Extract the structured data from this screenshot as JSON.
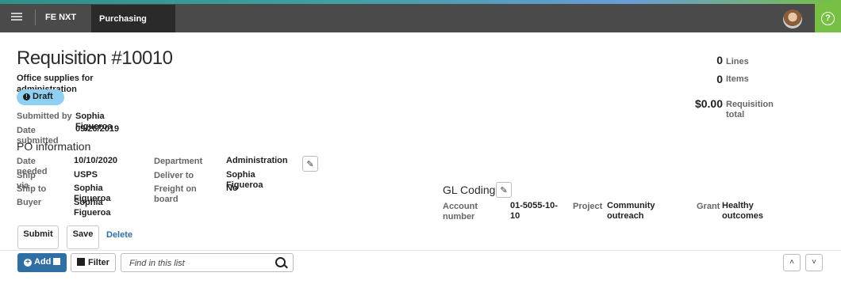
{
  "nav": {
    "app_name": "FE NXT",
    "active_tab": "Purchasing",
    "help_label": "?"
  },
  "header": {
    "title": "Requisition #10010",
    "description": "Office supplies for administration",
    "status": "Draft",
    "status_icon": "!"
  },
  "details": {
    "submitted_by_label": "Submitted by",
    "submitted_by_value": "Sophia Figueroa",
    "date_submitted_label": "Date submitted",
    "date_submitted_value": "09/26/2019"
  },
  "stats": [
    {
      "value": "0",
      "label": "Lines"
    },
    {
      "value": "0",
      "label": "Items"
    },
    {
      "value": "$0.00",
      "label": "Requisition total"
    }
  ],
  "po": {
    "section_title": "PO information",
    "date_needed_label": "Date needed",
    "date_needed_value": "10/10/2020",
    "ship_via_label": "Ship via",
    "ship_via_value": "USPS",
    "ship_to_label": "Ship to",
    "ship_to_value": "Sophia Figueroa",
    "buyer_label": "Buyer",
    "buyer_value": "Sophia Figueroa",
    "department_label": "Department",
    "department_value": "Administration",
    "deliver_to_label": "Deliver to",
    "deliver_to_value": "Sophia Figueroa",
    "freight_label": "Freight on board",
    "freight_value": "No"
  },
  "gl": {
    "section_title": "GL Coding",
    "account_label": "Account number",
    "account_value": "01-5055-10-10",
    "project_label": "Project",
    "project_value": "Community outreach",
    "grant_label": "Grant",
    "grant_value": "Healthy outcomes"
  },
  "actions": {
    "submit": "Submit",
    "save": "Save",
    "delete": "Delete"
  },
  "list_toolbar": {
    "add": "Add",
    "filter": "Filter",
    "search_placeholder": "Find in this list"
  },
  "colors": {
    "accent_blue": "#2f6fa3",
    "help_green": "#77c043",
    "draft_badge": "#8fd0f2"
  }
}
